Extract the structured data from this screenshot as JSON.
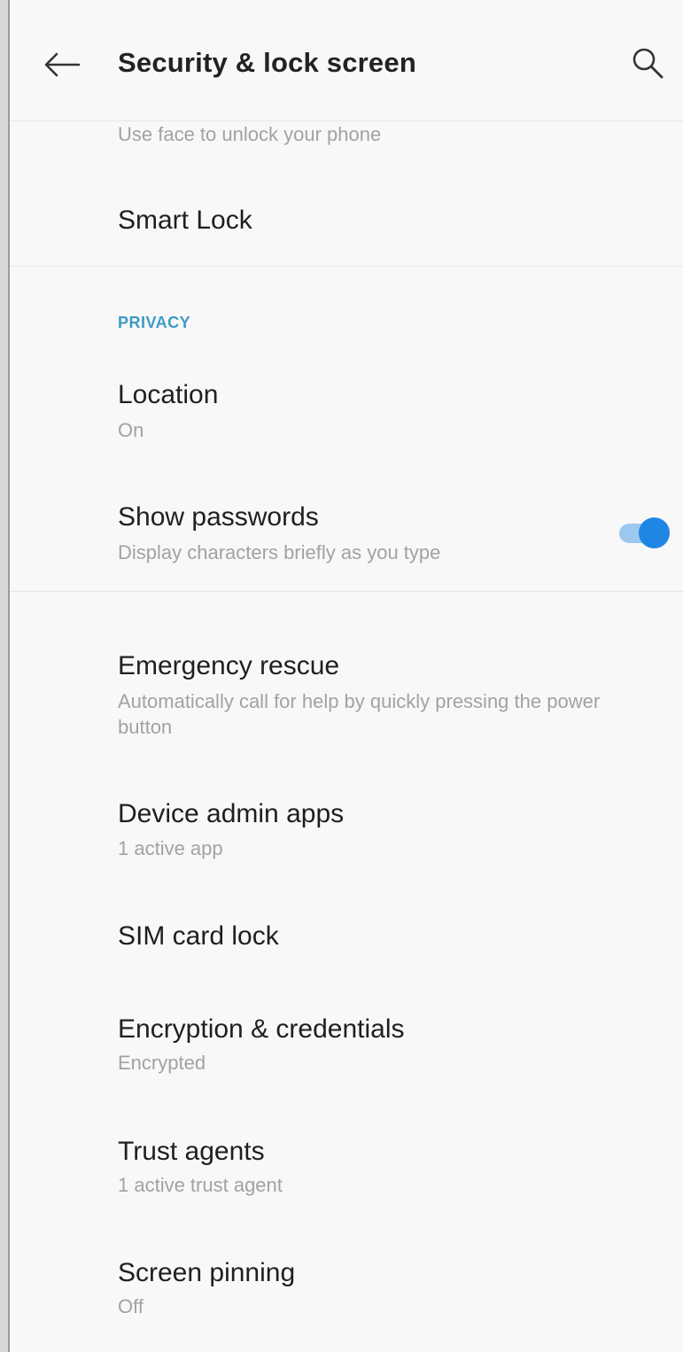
{
  "app_bar": {
    "title": "Security & lock screen",
    "back_icon": "arrow-left-icon",
    "search_icon": "search-icon"
  },
  "face_unlock": {
    "summary": "Use face to unlock your phone"
  },
  "smart_lock": {
    "label": "Smart Lock"
  },
  "privacy_section": {
    "header": "PRIVACY",
    "accent_color": "#3d9bc5"
  },
  "location": {
    "label": "Location",
    "summary": "On"
  },
  "show_passwords": {
    "label": "Show passwords",
    "summary": "Display characters briefly as you type",
    "enabled": true,
    "toggle_color": "#1f86e3"
  },
  "emergency_rescue": {
    "label": "Emergency rescue",
    "summary_line1": "Automatically call for help by quickly pressing the power",
    "summary_line2": "button"
  },
  "device_admin": {
    "label": "Device admin apps",
    "summary": "1 active app"
  },
  "sim_lock": {
    "label": "SIM card lock"
  },
  "encryption": {
    "label": "Encryption & credentials",
    "summary": "Encrypted"
  },
  "trust_agents": {
    "label": "Trust agents",
    "summary": "1 active trust agent"
  },
  "screen_pinning": {
    "label": "Screen pinning",
    "summary": "Off"
  }
}
